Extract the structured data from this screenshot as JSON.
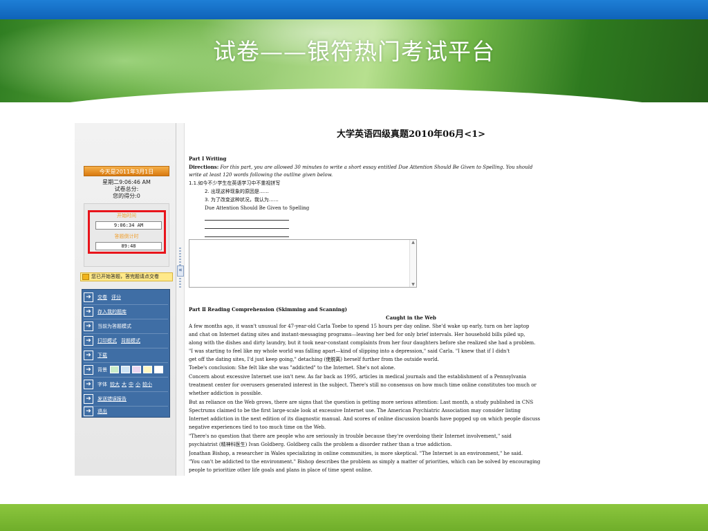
{
  "slide": {
    "title": "试卷——银符热门考试平台"
  },
  "sidebar": {
    "date_badge": "今天是2011年3月1日",
    "clock_line": "星期二9:06:46 AM",
    "score_total": "试卷总分:",
    "score_mine": "您的得分:0",
    "start_time_label": "开始时间",
    "start_time_value": "9:06:34 AM",
    "countdown_label": "答题倒计时",
    "countdown_value": "89:48",
    "notice": "您已开始答题，答完题请点交卷",
    "menu": [
      {
        "links": [
          "交卷",
          "评分"
        ]
      },
      {
        "links": [
          "存入我的题库"
        ]
      },
      {
        "text": "当前为答题模式"
      },
      {
        "links": [
          "打印模式",
          "背题模式"
        ]
      },
      {
        "links": [
          "下载"
        ]
      },
      {
        "text": "背景",
        "swatches": [
          "#c9ecc9",
          "#cfe4f4",
          "#ecd7f0",
          "#fff7c2",
          "#ffffff"
        ]
      },
      {
        "text": "字体",
        "links": [
          "较大",
          "大",
          "中",
          "小",
          "较小"
        ]
      },
      {
        "links": [
          "发送错误报告"
        ]
      },
      {
        "links": [
          "退出"
        ]
      }
    ],
    "collapse_glyph": "«"
  },
  "content": {
    "title": "大学英语四级真题2010年06月<1>",
    "part1_heading": "Part Ⅰ Writing",
    "directions_label": "Directions:",
    "directions_text": " For this part, you are allowed 30 minutes to write a short essay entitled Due Attention Should Be Given to Spelling. You should",
    "directions_text2": "write at least 120 words following the outline given below.",
    "outline": [
      "1.1.如今不少学生在英语学习中不重视拼写",
      "2. 出现这种现象的原因是……",
      "3. 为了改变这种状况，我认为……",
      "Due Attention Should Be Given to Spelling"
    ],
    "part2_heading": "Part Ⅱ Reading Comprehension (Skimming and Scanning)",
    "passage_title": "Caught in the Web",
    "passage_lines": [
      "   A few months ago, it wasn't unusual for 47-year-old Carla Toebe to spend 15 hours per day online. She'd wake up early, turn on her laptop",
      "and chat on Internet dating sites and instant-messaging programs—leaving her bed for only brief intervals. Her household bills piled up,",
      "along with the dishes and dirty laundry, but it took near-constant complaints from her four daughters before she realized she had a problem.",
      "   \"I was starting to feel like my whole world was falling apart—kind of slipping into a depression,\" said Carla. \"I knew that if I didn't",
      "get off the dating sites, I'd just keep going,\" detaching (使脱离) herself further from the outside world.",
      "   Toebe's conclusion: She felt like she was \"addicted\" to the Internet. She's not alone.",
      "   Concern about excessive Internet use isn't new. As far back as 1995, articles in medical journals and the establishment of a Pennsylvania",
      "treatment center for overusers generated interest in the subject. There's still no consensus on how much time online constitutes too much or",
      "whether addiction is possible.",
      "   But as reliance on the Web grows, there are signs that the question is getting more serious attention: Last month, a study published in CNS",
      "Spectrums claimed to be the first large-scale look at excessive Internet use. The American Psychiatric Association may consider listing",
      "Internet addiction in the next edition of its diagnostic manual. And scores of online discussion boards have popped up on which people discuss",
      "negative experiences tied to too much time on the Web.",
      "   \"There's no question that there are people who are seriously in trouble because they're overdoing their Internet involvement,\" said",
      "psychiatrist (精神科医生) Ivan Goldberg. Goldberg calls the problem a disorder rather than a true addiction.",
      "   Jonathan Bishop, a researcher in Wales specializing in online communities, is more skeptical. \"The Internet is an environment,\" he said.",
      "\"You can't be addicted to the environment.\" Bishop describes the problem as simply a matter of priorities, which can be solved by encouraging",
      "people to prioritize other life goals and plans in place of time spent online."
    ]
  }
}
